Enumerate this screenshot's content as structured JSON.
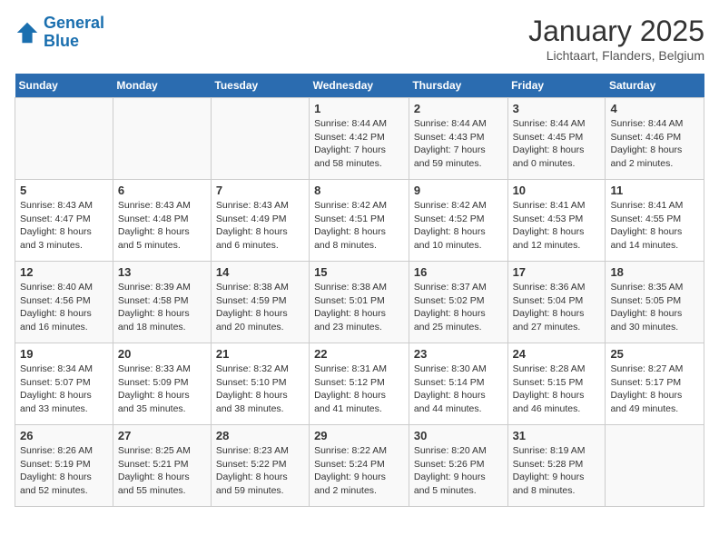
{
  "header": {
    "logo_line1": "General",
    "logo_line2": "Blue",
    "title": "January 2025",
    "subtitle": "Lichtaart, Flanders, Belgium"
  },
  "weekdays": [
    "Sunday",
    "Monday",
    "Tuesday",
    "Wednesday",
    "Thursday",
    "Friday",
    "Saturday"
  ],
  "weeks": [
    [
      {
        "day": "",
        "info": ""
      },
      {
        "day": "",
        "info": ""
      },
      {
        "day": "",
        "info": ""
      },
      {
        "day": "1",
        "info": "Sunrise: 8:44 AM\nSunset: 4:42 PM\nDaylight: 7 hours\nand 58 minutes."
      },
      {
        "day": "2",
        "info": "Sunrise: 8:44 AM\nSunset: 4:43 PM\nDaylight: 7 hours\nand 59 minutes."
      },
      {
        "day": "3",
        "info": "Sunrise: 8:44 AM\nSunset: 4:45 PM\nDaylight: 8 hours\nand 0 minutes."
      },
      {
        "day": "4",
        "info": "Sunrise: 8:44 AM\nSunset: 4:46 PM\nDaylight: 8 hours\nand 2 minutes."
      }
    ],
    [
      {
        "day": "5",
        "info": "Sunrise: 8:43 AM\nSunset: 4:47 PM\nDaylight: 8 hours\nand 3 minutes."
      },
      {
        "day": "6",
        "info": "Sunrise: 8:43 AM\nSunset: 4:48 PM\nDaylight: 8 hours\nand 5 minutes."
      },
      {
        "day": "7",
        "info": "Sunrise: 8:43 AM\nSunset: 4:49 PM\nDaylight: 8 hours\nand 6 minutes."
      },
      {
        "day": "8",
        "info": "Sunrise: 8:42 AM\nSunset: 4:51 PM\nDaylight: 8 hours\nand 8 minutes."
      },
      {
        "day": "9",
        "info": "Sunrise: 8:42 AM\nSunset: 4:52 PM\nDaylight: 8 hours\nand 10 minutes."
      },
      {
        "day": "10",
        "info": "Sunrise: 8:41 AM\nSunset: 4:53 PM\nDaylight: 8 hours\nand 12 minutes."
      },
      {
        "day": "11",
        "info": "Sunrise: 8:41 AM\nSunset: 4:55 PM\nDaylight: 8 hours\nand 14 minutes."
      }
    ],
    [
      {
        "day": "12",
        "info": "Sunrise: 8:40 AM\nSunset: 4:56 PM\nDaylight: 8 hours\nand 16 minutes."
      },
      {
        "day": "13",
        "info": "Sunrise: 8:39 AM\nSunset: 4:58 PM\nDaylight: 8 hours\nand 18 minutes."
      },
      {
        "day": "14",
        "info": "Sunrise: 8:38 AM\nSunset: 4:59 PM\nDaylight: 8 hours\nand 20 minutes."
      },
      {
        "day": "15",
        "info": "Sunrise: 8:38 AM\nSunset: 5:01 PM\nDaylight: 8 hours\nand 23 minutes."
      },
      {
        "day": "16",
        "info": "Sunrise: 8:37 AM\nSunset: 5:02 PM\nDaylight: 8 hours\nand 25 minutes."
      },
      {
        "day": "17",
        "info": "Sunrise: 8:36 AM\nSunset: 5:04 PM\nDaylight: 8 hours\nand 27 minutes."
      },
      {
        "day": "18",
        "info": "Sunrise: 8:35 AM\nSunset: 5:05 PM\nDaylight: 8 hours\nand 30 minutes."
      }
    ],
    [
      {
        "day": "19",
        "info": "Sunrise: 8:34 AM\nSunset: 5:07 PM\nDaylight: 8 hours\nand 33 minutes."
      },
      {
        "day": "20",
        "info": "Sunrise: 8:33 AM\nSunset: 5:09 PM\nDaylight: 8 hours\nand 35 minutes."
      },
      {
        "day": "21",
        "info": "Sunrise: 8:32 AM\nSunset: 5:10 PM\nDaylight: 8 hours\nand 38 minutes."
      },
      {
        "day": "22",
        "info": "Sunrise: 8:31 AM\nSunset: 5:12 PM\nDaylight: 8 hours\nand 41 minutes."
      },
      {
        "day": "23",
        "info": "Sunrise: 8:30 AM\nSunset: 5:14 PM\nDaylight: 8 hours\nand 44 minutes."
      },
      {
        "day": "24",
        "info": "Sunrise: 8:28 AM\nSunset: 5:15 PM\nDaylight: 8 hours\nand 46 minutes."
      },
      {
        "day": "25",
        "info": "Sunrise: 8:27 AM\nSunset: 5:17 PM\nDaylight: 8 hours\nand 49 minutes."
      }
    ],
    [
      {
        "day": "26",
        "info": "Sunrise: 8:26 AM\nSunset: 5:19 PM\nDaylight: 8 hours\nand 52 minutes."
      },
      {
        "day": "27",
        "info": "Sunrise: 8:25 AM\nSunset: 5:21 PM\nDaylight: 8 hours\nand 55 minutes."
      },
      {
        "day": "28",
        "info": "Sunrise: 8:23 AM\nSunset: 5:22 PM\nDaylight: 8 hours\nand 59 minutes."
      },
      {
        "day": "29",
        "info": "Sunrise: 8:22 AM\nSunset: 5:24 PM\nDaylight: 9 hours\nand 2 minutes."
      },
      {
        "day": "30",
        "info": "Sunrise: 8:20 AM\nSunset: 5:26 PM\nDaylight: 9 hours\nand 5 minutes."
      },
      {
        "day": "31",
        "info": "Sunrise: 8:19 AM\nSunset: 5:28 PM\nDaylight: 9 hours\nand 8 minutes."
      },
      {
        "day": "",
        "info": ""
      }
    ]
  ]
}
